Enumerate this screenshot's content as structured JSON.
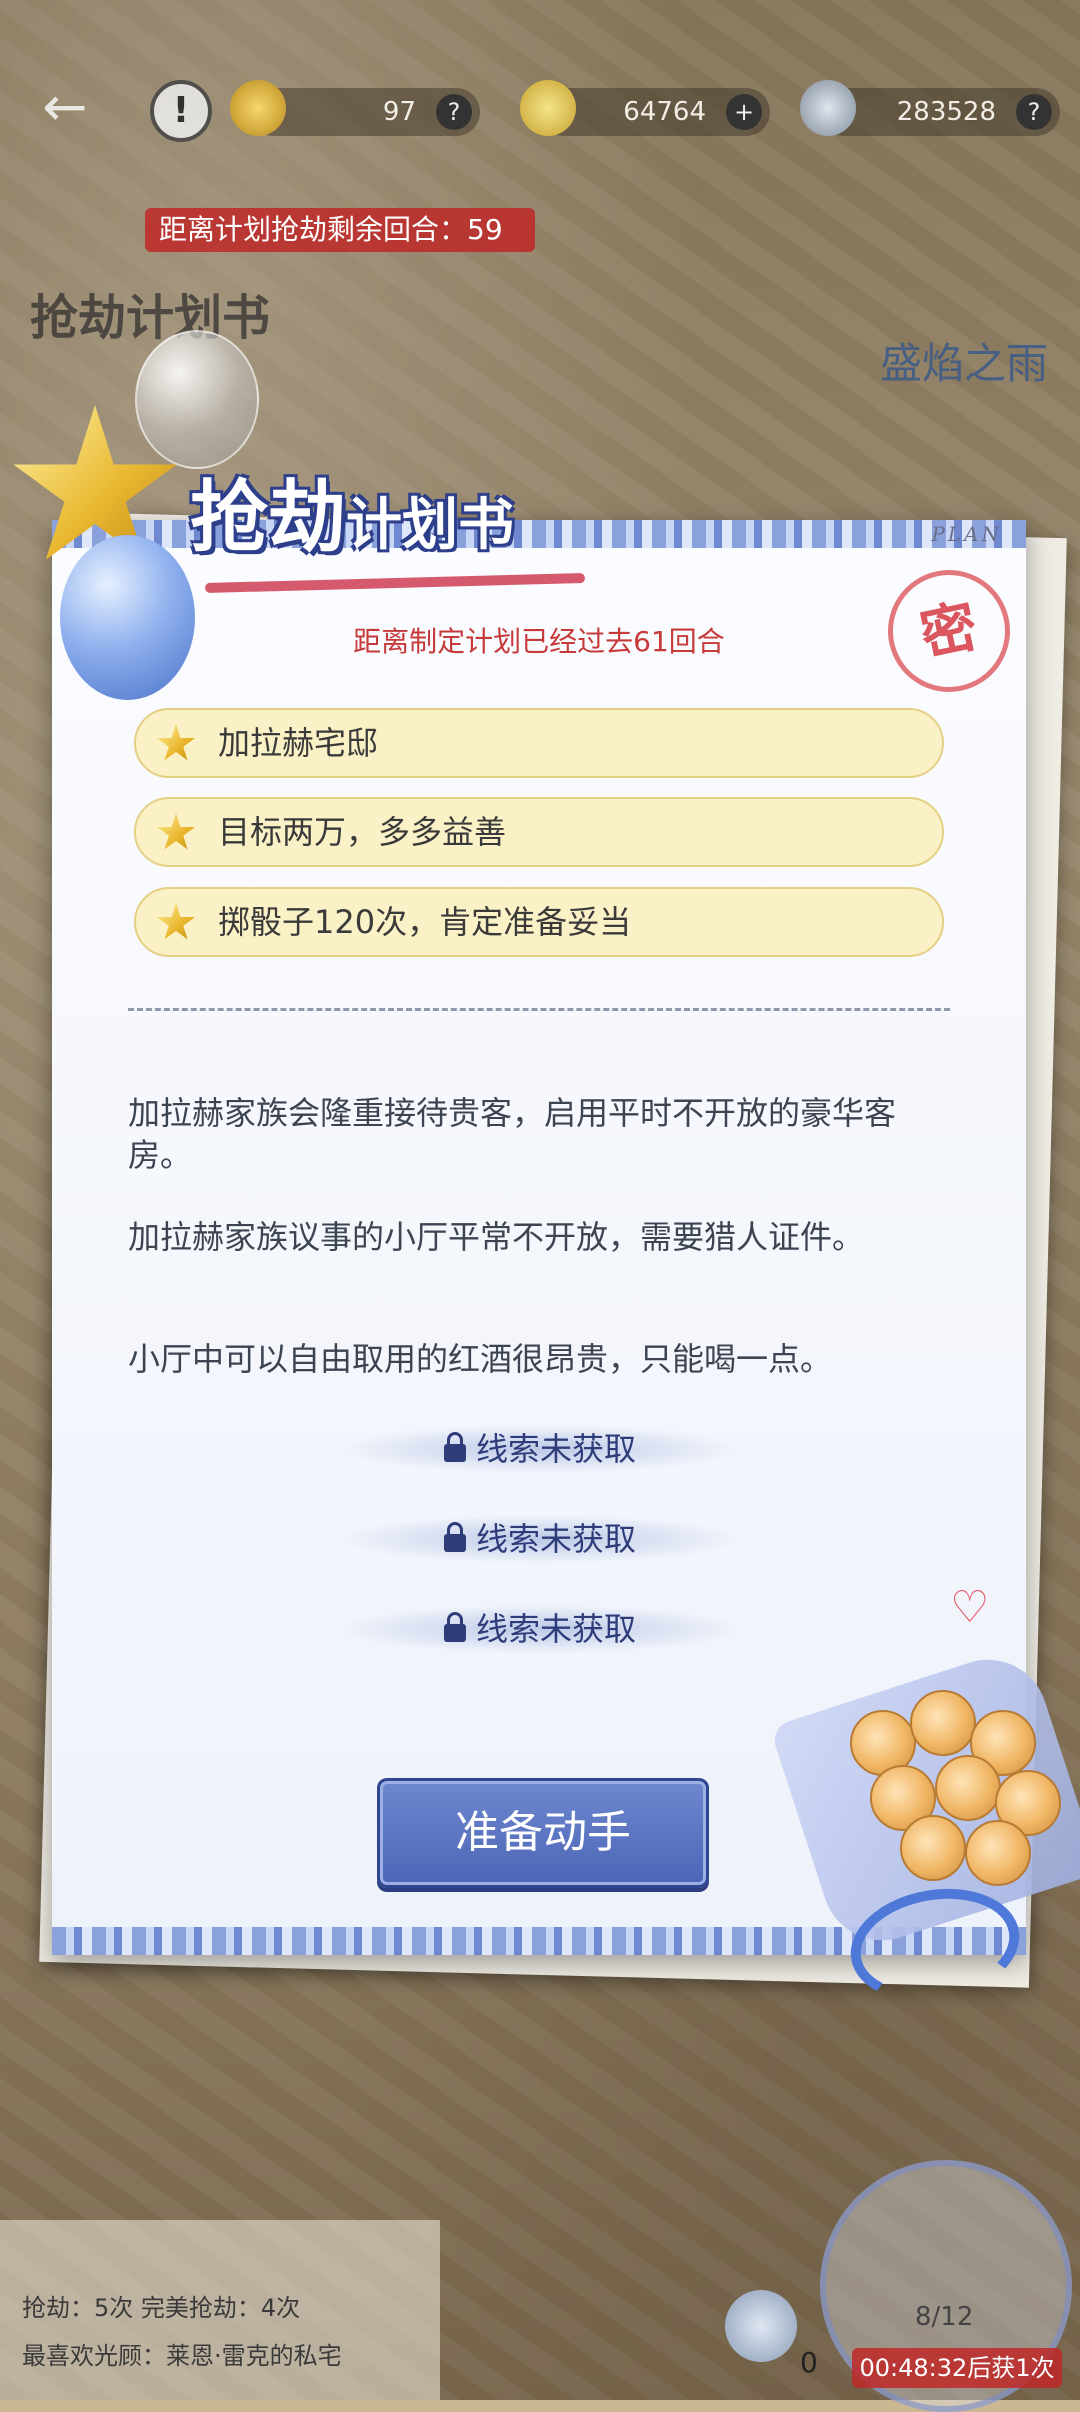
{
  "topbar": {
    "stat1": "97",
    "gold": "64764",
    "diamond": "283528",
    "help": "?",
    "plus": "+"
  },
  "countdown": "距离计划抢劫剩余回合：59",
  "event_label": "盛焰之雨",
  "plan_label_left": "抢劫计划书",
  "panel": {
    "plan_tag": "PLAN",
    "title_big": "抢劫",
    "title_small": "计划书",
    "stamp": "密",
    "elapsed": "距离制定计划已经过去61回合",
    "goals": [
      "加拉赫宅邸",
      "目标两万，多多益善",
      "掷骰子120次，肯定准备妥当"
    ],
    "clues": [
      "加拉赫家族会隆重接待贵客，启用平时不开放的豪华客房。",
      "加拉赫家族议事的小厅平常不开放，需要猎人证件。",
      "小厅中可以自由取用的红酒很昂贵，只能喝一点。"
    ],
    "locked_clue": "线索未获取",
    "action_button": "准备动手"
  },
  "bottom": {
    "stats": "抢劫：5次  完美抢劫：4次",
    "favorite": "最喜欢光顾：莱恩·雷克的私宅",
    "feather_count": "0",
    "progress": "8/12",
    "timer": "00:48:32后获1次"
  }
}
